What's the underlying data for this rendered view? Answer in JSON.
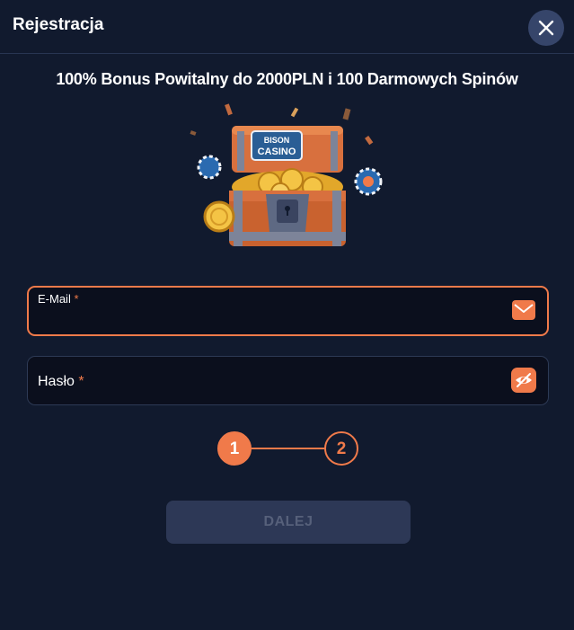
{
  "header": {
    "title": "Rejestracja",
    "close_icon": "close-icon"
  },
  "promo": {
    "headline": "100% Bonus Powitalny do 2000PLN i 100 Darmowych Spinów"
  },
  "illustration": {
    "logo_line1": "BISON",
    "logo_line2": "CASINO"
  },
  "form": {
    "email": {
      "label": "E-Mail",
      "required_mark": "*",
      "value": "",
      "icon": "envelope-icon",
      "state": "focused"
    },
    "password": {
      "label": "Hasło",
      "required_mark": "*",
      "value": "",
      "icon": "eye-toggle-icon"
    }
  },
  "steps": {
    "items": [
      "1",
      "2"
    ],
    "current": 1
  },
  "actions": {
    "next_label": "DALEJ",
    "next_enabled": false
  },
  "colors": {
    "background": "#111a2e",
    "accent": "#f07a4a",
    "input_bg": "#0b0f1d",
    "button_disabled": "#2d3856"
  }
}
